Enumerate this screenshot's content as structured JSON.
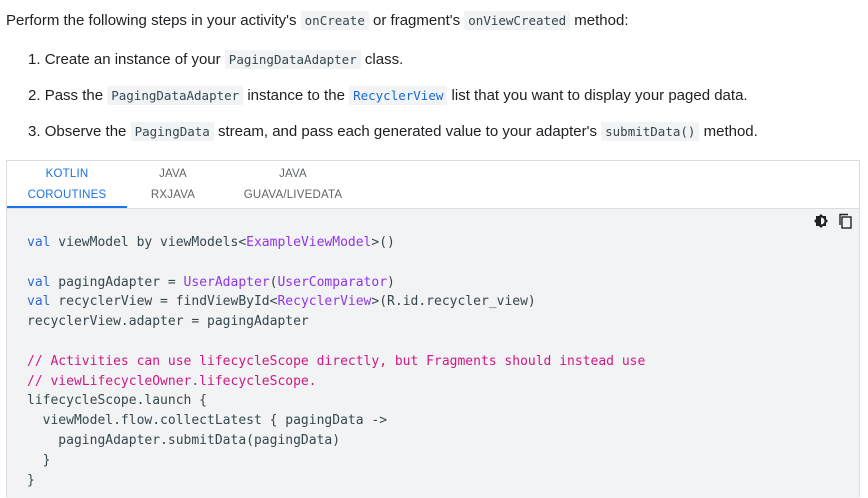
{
  "intro": {
    "before": "Perform the following steps in your activity's ",
    "code1": "onCreate",
    "middle": " or fragment's ",
    "code2": "onViewCreated",
    "after": " method:"
  },
  "steps": [
    {
      "num": "1.",
      "t1": "Create an instance of your ",
      "c1": "PagingDataAdapter",
      "t2": " class."
    },
    {
      "num": "2.",
      "t1": "Pass the ",
      "c1": "PagingDataAdapter",
      "t2": " instance to the ",
      "c2": "RecyclerView",
      "t3": " list that you want to display your paged data."
    },
    {
      "num": "3.",
      "t1": "Observe the ",
      "c1": "PagingData",
      "t2": " stream, and pass each generated value to your adapter's ",
      "c2": "submitData()",
      "t3": " method."
    }
  ],
  "tabs": [
    {
      "line1": "KOTLIN",
      "line2": "COROUTINES"
    },
    {
      "line1": "JAVA",
      "line2": "RXJAVA"
    },
    {
      "line1": "JAVA",
      "line2": "GUAVA/LIVEDATA"
    }
  ],
  "active_tab": 0,
  "icons": [
    "theme-toggle-icon",
    "copy-icon"
  ],
  "colors": {
    "keyword": "#3367d6",
    "type": "#9334e6",
    "comment": "#d01884",
    "tab_active": "#1a73e8",
    "code_bg": "#f1f3f4"
  },
  "code": {
    "l1": {
      "kw": "val",
      "a": " viewModel by viewModels<",
      "ty": "ExampleViewModel",
      "b": ">()"
    },
    "l2": {
      "kw": "val",
      "a": " pagingAdapter = ",
      "ty": "UserAdapter",
      "b": "(",
      "ty2": "UserComparator",
      "c": ")"
    },
    "l3": {
      "kw": "val",
      "a": " recyclerView = findViewById<",
      "ty": "RecyclerView",
      "b": ">(R.id.recycler_view)"
    },
    "l4": "recyclerView.adapter = pagingAdapter",
    "l5": "// Activities can use lifecycleScope directly, but Fragments should instead use",
    "l6": "// viewLifecycleOwner.lifecycleScope.",
    "l7": "lifecycleScope.launch {",
    "l8": "  viewModel.flow.collectLatest { pagingData ->",
    "l9": "    pagingAdapter.submitData(pagingData)",
    "l10": "  }",
    "l11": "}"
  }
}
